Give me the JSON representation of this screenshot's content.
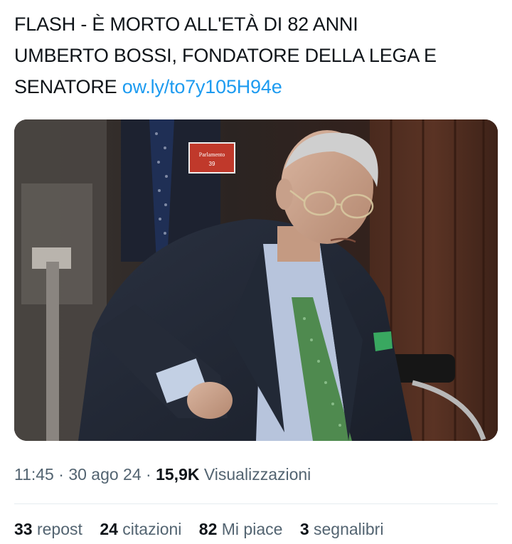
{
  "tweet": {
    "lines": [
      "FLASH - È MORTO ALL'ETÀ DI 82 ANNI",
      "UMBERTO BOSSI, FONDATORE DELLA LEGA E",
      "SENATORE "
    ],
    "link": "ow.ly/to7y105H94e"
  },
  "media": {
    "badge_text": "Parlamento",
    "badge_number": "39"
  },
  "meta": {
    "time": "11:45",
    "sep1": " · ",
    "date": "30 ago 24",
    "sep2": " · ",
    "views_count": "15,9K",
    "views_label": " Visualizzazioni"
  },
  "stats": [
    {
      "num": "33",
      "label": " repost"
    },
    {
      "num": "24",
      "label": " citazioni"
    },
    {
      "num": "82",
      "label": " Mi piace"
    },
    {
      "num": "3",
      "label": " segnalibri"
    }
  ],
  "colors": {
    "link": "#1d9bf0",
    "text": "#0f1419",
    "muted": "#536471"
  }
}
